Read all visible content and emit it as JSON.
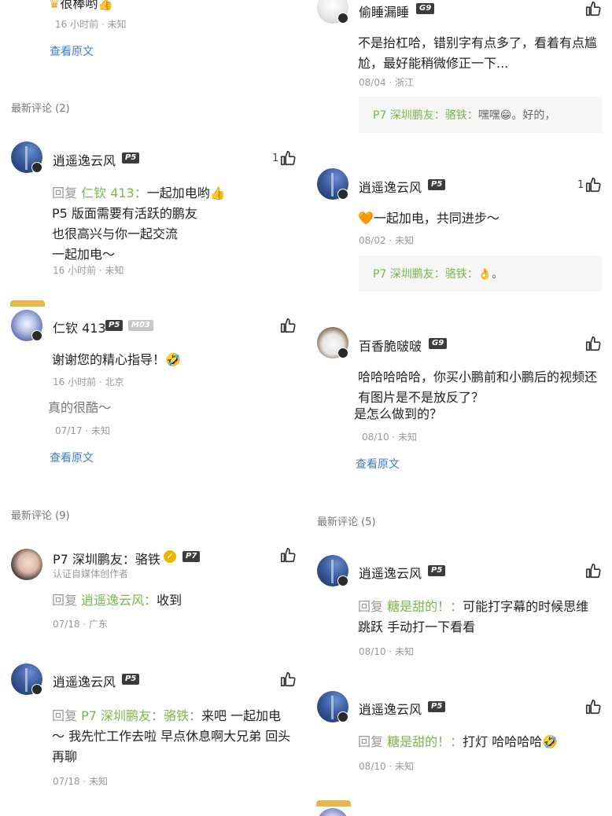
{
  "left": {
    "top_fragment": {
      "text": "很棒哟",
      "meta": "16 小时前 · 未知",
      "link": "查看原文"
    },
    "section1": "最新评论 (2)",
    "c1": {
      "name": "逍遥逸云风",
      "level": "P5",
      "like_count": "1",
      "reply_kw": "回复",
      "reply_to": "仁钦 413：",
      "line1": "一起加电哟👍",
      "line2": "P5 版面需要有活跃的鹏友",
      "line3": "也很高兴与你一起交流",
      "line4": "一起加电～",
      "meta": "16 小时前 · 未知"
    },
    "c2": {
      "name": "仁钦 413",
      "level": "P5",
      "level2": "M03",
      "text": "谢谢您的精心指导！🤣",
      "meta": "16 小时前 · 北京",
      "quoted": "真的很酷～",
      "quoted_meta": "07/17 · 未知",
      "link": "查看原文"
    },
    "section2": "最新评论 (9)",
    "c3": {
      "name": "P7 深圳鹏友：骆铁",
      "level": "P7",
      "subtitle": "认证自媒体创作者",
      "reply_kw": "回复",
      "reply_to": "逍遥逸云风：",
      "text": "收到",
      "meta": "07/18 · 广东"
    },
    "c4": {
      "name": "逍遥逸云风",
      "level": "P5",
      "reply_kw": "回复",
      "reply_to": "P7 深圳鹏友：骆铁：",
      "line1": "来吧  一起加电",
      "line2": "～  我先忙工作去啦 早点休息啊大兄弟 回头",
      "line3": "再聊",
      "meta": "07/18 · 未知"
    }
  },
  "right": {
    "c1": {
      "name": "偷睡漏睡",
      "level": "G9",
      "line1": "不是抬杠哈，错别字有点多了，看着有点尴",
      "line2": "尬，最好能稍微修正一下...",
      "meta": "08/04 · 浙江",
      "quote_name": "P7 深圳鹏友：骆铁：",
      "quote_text": "嘿嘿😁。好的，"
    },
    "c2": {
      "name": "逍遥逸云风",
      "level": "P5",
      "like_count": "1",
      "text": "🧡一起加电，共同进步～",
      "meta": "08/02 · 未知",
      "quote_name": "P7 深圳鹏友：骆铁：",
      "quote_text": "👌。"
    },
    "c3": {
      "name": "百香脆啵啵",
      "level": "G9",
      "line1": "哈哈哈哈哈，你买小鹏前和小鹏后的视频还",
      "line2": "有图片是不是放反了？",
      "line3": "是怎么做到的？",
      "meta": "08/10 · 未知",
      "link": "查看原文"
    },
    "section": "最新评论 (5)",
    "c4": {
      "name": "逍遥逸云风",
      "level": "P5",
      "reply_kw": "回复",
      "reply_to": "糖是甜的！：",
      "line1": "可能打字幕的时候思维",
      "line2": "跳跃  手动打一下看看",
      "meta": "08/10 · 未知"
    },
    "c5": {
      "name": "逍遥逸云风",
      "level": "P5",
      "reply_kw": "回复",
      "reply_to": "糖是甜的！：",
      "text": "打灯  哈哈哈哈🤣",
      "meta": "08/10 · 未知"
    }
  },
  "colors": {
    "reply_name": "#7bb54b",
    "link": "#3f7cd0",
    "meta": "#999999",
    "level_bg": "#3c3c3c"
  },
  "icons": [
    "thumbs-up-icon",
    "verified-icon",
    "avatar-badge-icon"
  ]
}
